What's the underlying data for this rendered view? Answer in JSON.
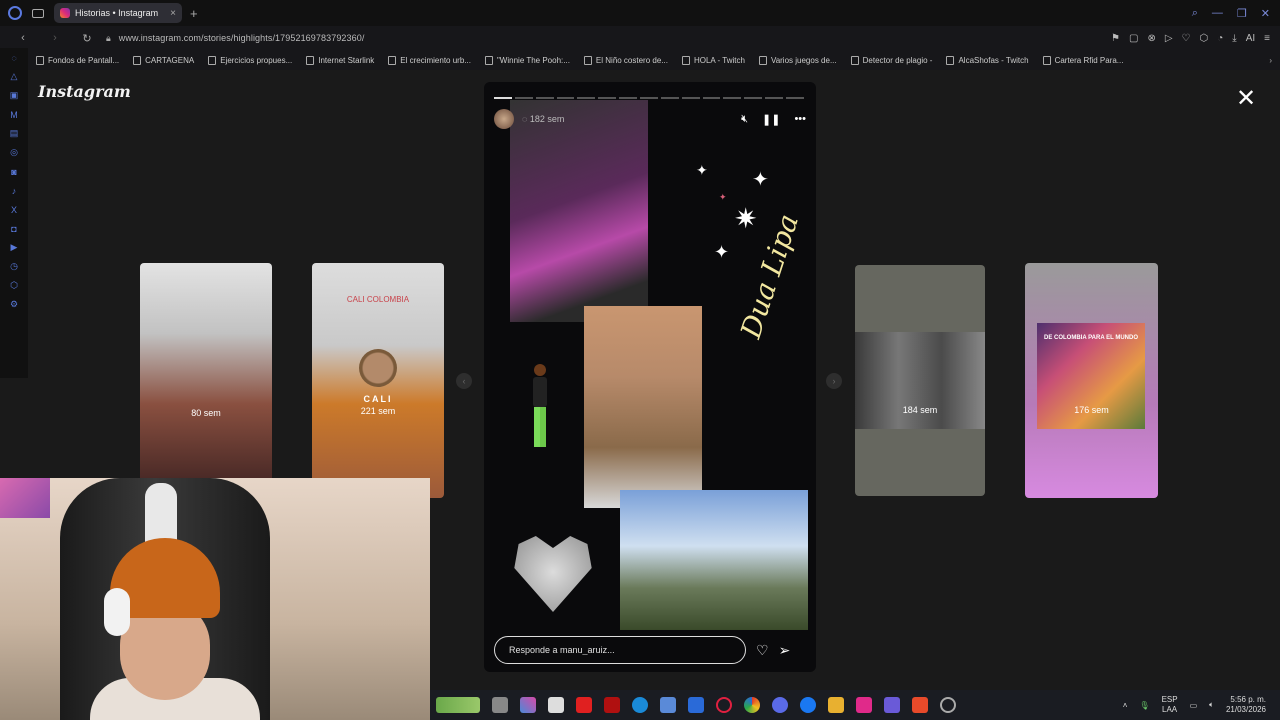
{
  "browser": {
    "tab_title": "Historias • Instagram",
    "url": "www.instagram.com/stories/highlights/17952169783792360/",
    "bookmarks": [
      {
        "label": "Fondos de Pantall..."
      },
      {
        "label": "CARTAGENA"
      },
      {
        "label": "Ejercicios propues..."
      },
      {
        "label": "Internet Starlink"
      },
      {
        "label": "El crecimiento urb..."
      },
      {
        "label": "\"Winnie The Pooh:..."
      },
      {
        "label": "El Niño costero de..."
      },
      {
        "label": "HOLA - Twitch"
      },
      {
        "label": "Varios juegos de..."
      },
      {
        "label": "Detector de plagio -"
      },
      {
        "label": "AlcaShofas - Twitch"
      },
      {
        "label": "Cartera Rfid Para..."
      }
    ],
    "ai_label": "AI"
  },
  "instagram": {
    "logo": "Instagram",
    "side_stories": [
      {
        "time": "80 sem",
        "name": ""
      },
      {
        "time": "221 sem",
        "name": "CALI",
        "tag": "CALI COLOMBIA"
      },
      {
        "time": "184 sem",
        "name": ""
      },
      {
        "time": "176 sem",
        "name": "",
        "banner": "DE COLOMBIA PARA EL MUNDO"
      }
    ],
    "main_story": {
      "time": "182 sem",
      "signature": "Dua Lipa",
      "reply_placeholder": "Responde a manu_aruiz...",
      "progress_total": 15,
      "progress_done": 1
    }
  },
  "taskbar": {
    "lang_1": "ESP",
    "lang_2": "LAA",
    "time": "5:56 p. m.",
    "date": "21/03/2026"
  },
  "colors": {
    "accent": "#5878d8",
    "page_bg": "#1a1a1a",
    "story_bg": "#0a0a0c"
  }
}
